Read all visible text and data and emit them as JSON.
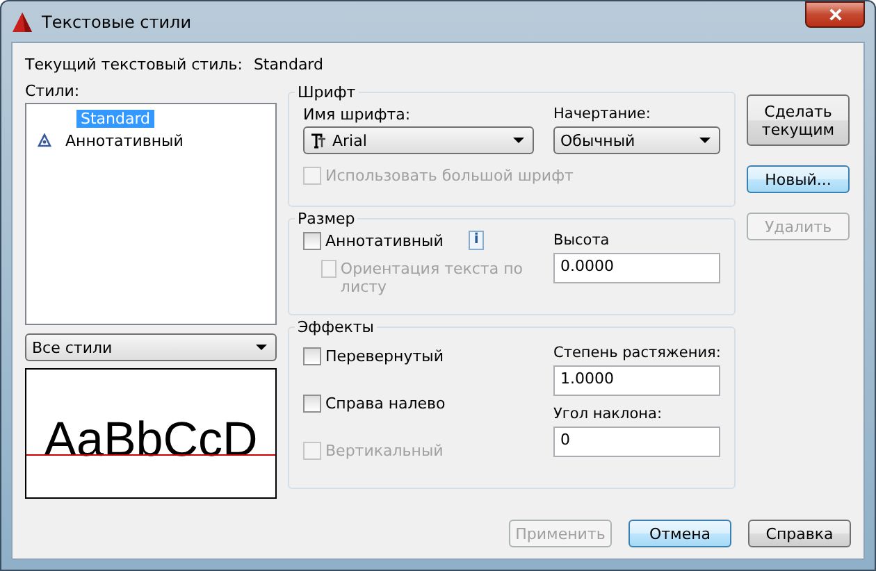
{
  "window": {
    "title": "Текстовые стили"
  },
  "current_style": {
    "label": "Текущий текстовый стиль:",
    "value": "Standard"
  },
  "styles": {
    "label": "Стили:",
    "items": [
      {
        "name": "Standard",
        "kind": "plain",
        "selected": true
      },
      {
        "name": "Аннотативный",
        "kind": "annotative",
        "selected": false
      }
    ]
  },
  "filter": {
    "value": "Все стили"
  },
  "preview": {
    "text": "AaBbCcD"
  },
  "font": {
    "title": "Шрифт",
    "font_name": {
      "label": "Имя шрифта:",
      "value": "Arial"
    },
    "font_style": {
      "label": "Начертание:",
      "value": "Обычный"
    },
    "big_font": {
      "label": "Использовать большой шрифт",
      "checked": false,
      "disabled": true
    }
  },
  "size": {
    "title": "Размер",
    "annotative": {
      "label": "Аннотативный",
      "checked": false,
      "disabled": false
    },
    "info": "i",
    "orientation": {
      "label": "Ориентация текста по листу",
      "checked": false,
      "disabled": true
    },
    "height": {
      "label": "Высота",
      "value": "0.0000"
    }
  },
  "effects": {
    "title": "Эффекты",
    "checks": [
      {
        "label": "Перевернутый",
        "checked": false,
        "disabled": false
      },
      {
        "label": "Справа налево",
        "checked": false,
        "disabled": false
      },
      {
        "label": "Вертикальный",
        "checked": false,
        "disabled": true
      }
    ],
    "width_factor": {
      "label": "Степень растяжения:",
      "value": "1.0000"
    },
    "oblique": {
      "label": "Угол наклона:",
      "value": "0"
    }
  },
  "side_buttons": [
    {
      "label": "Сделать текущим",
      "disabled": false,
      "focused": false
    },
    {
      "label": "Новый...",
      "disabled": false,
      "focused": true
    },
    {
      "label": "Удалить",
      "disabled": true,
      "focused": false
    }
  ],
  "bottom_buttons": [
    {
      "label": "Применить",
      "disabled": true,
      "focused": false
    },
    {
      "label": "Отмена",
      "disabled": false,
      "focused": true
    },
    {
      "label": "Справка",
      "disabled": false,
      "focused": false
    }
  ]
}
